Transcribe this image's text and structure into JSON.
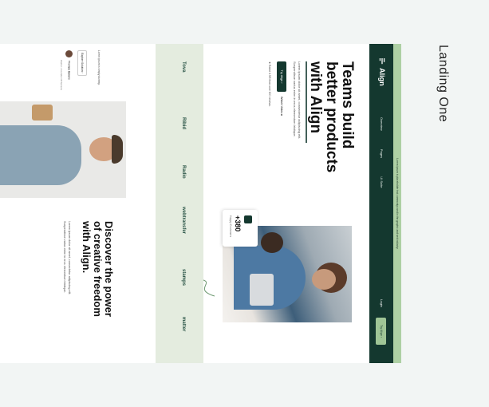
{
  "presentation_title": "Landing One",
  "banner": {
    "text": "Lorem ipsum is placeholder text commonly used in the graphic and web industry"
  },
  "nav": {
    "logo": "Align",
    "links": [
      "Overview",
      "Pages",
      "UI Suite"
    ],
    "login": "Login",
    "cta": "Try Align"
  },
  "hero": {
    "title_lines": [
      "Teams build",
      "better products",
      "with Align"
    ],
    "description": "Lorem ipsum dolor sit amet, consectetur adipiscing elit. Suspendisse varius enim in eros elementum tristique.",
    "primary_button": "Try Align",
    "secondary_button": "Watch Video",
    "rating_text": "Rated 4.9/5 from over 600 reviews."
  },
  "stat": {
    "value": "+380",
    "label": "Happy Customers"
  },
  "logos": [
    "Tova",
    "Ribid",
    "Radio",
    "webtransfer",
    "stamps",
    "matter"
  ],
  "section2": {
    "title_lines": [
      "Discover the power",
      "of creative freedom",
      "with Align."
    ],
    "description": "Lorem ipsum dolor sit amet, consectetur adipiscing elit. Suspendisse varius enim in eros elementum tristique.",
    "small_text": "Lorem ipsum is simply dummy.",
    "button": "Explore Solution",
    "person_name": "Thomas Bakers",
    "person_role": "Owner • Founder Of Seneca"
  },
  "colors": {
    "brand_dark": "#14382f",
    "brand_light": "#aed0a4",
    "logos_bg": "#e4ecdf"
  }
}
